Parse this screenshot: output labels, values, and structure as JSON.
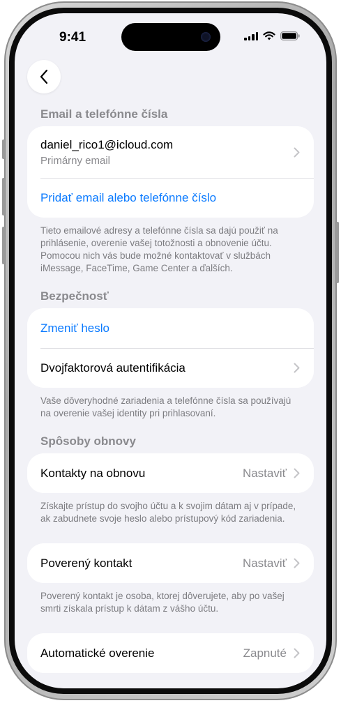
{
  "status_bar": {
    "time": "9:41"
  },
  "navigation": {
    "back_icon": "chevron-left-icon"
  },
  "sections": {
    "email": {
      "header": "Email a telefónne čísla",
      "address": "daniel_rico1@icloud.com",
      "address_sub": "Primárny email",
      "add_link": "Pridať email alebo telefónne číslo",
      "footer": "Tieto emailové adresy a telefónne čísla sa dajú použiť na prihlásenie, overenie vašej totožnosti a obnovenie účtu. Pomocou nich vás bude možné kontaktovať v službách iMessage, FaceTime, Game Center a ďalších."
    },
    "security": {
      "header": "Bezpečnosť",
      "change_password": "Zmeniť heslo",
      "two_factor": "Dvojfaktorová autentifikácia",
      "footer": "Vaše dôveryhodné zariadenia a telefónne čísla sa používajú na overenie vašej identity pri prihlasovaní."
    },
    "recovery": {
      "header": "Spôsoby obnovy",
      "recovery_contacts": "Kontakty na obnovu",
      "recovery_contacts_value": "Nastaviť",
      "footer": "Získajte prístup do svojho účtu a k svojim dátam aj v prípade, ak zabudnete svoje heslo alebo prístupový kód zariadenia."
    },
    "legacy": {
      "legacy_contact": "Poverený kontakt",
      "legacy_contact_value": "Nastaviť",
      "footer": "Poverený kontakt je osoba, ktorej dôverujete, aby po vašej smrti získala prístup k dátam z vášho účtu."
    },
    "auto": {
      "auto_verification": "Automatické overenie",
      "auto_verification_value": "Zapnuté"
    }
  },
  "colors": {
    "accent": "#0a7aff",
    "background": "#f2f2f7",
    "secondary_text": "#8a8a8e"
  }
}
